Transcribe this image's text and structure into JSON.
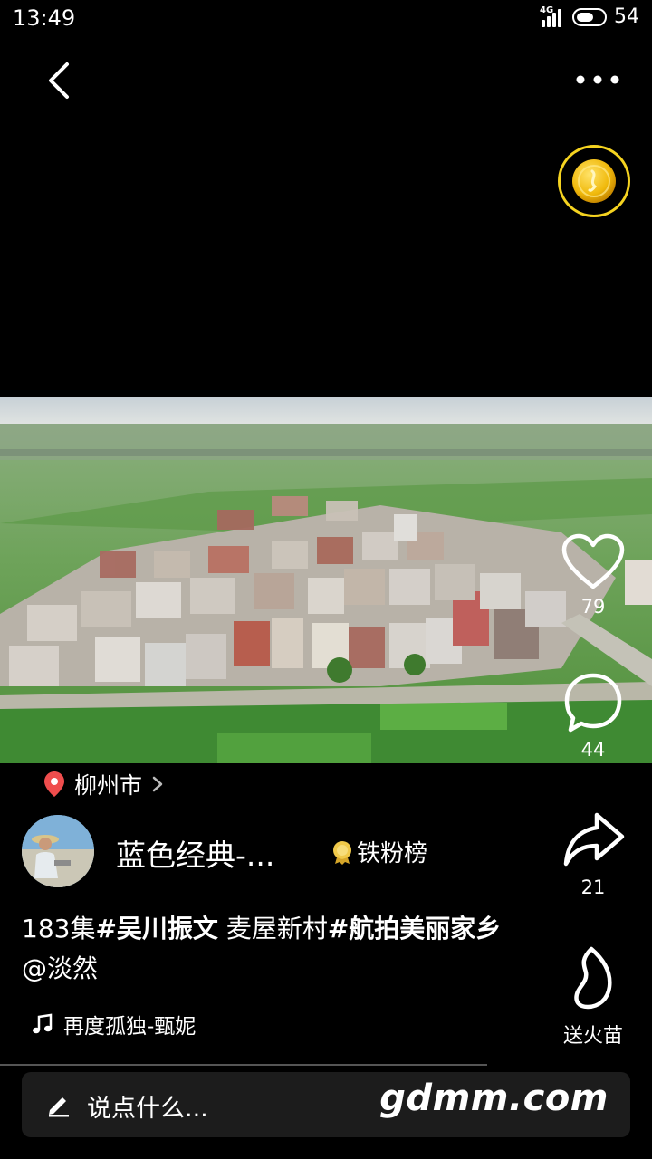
{
  "status_bar": {
    "time": "13:49",
    "network": "4G",
    "battery_level": "54"
  },
  "icons": {
    "back": "back-chevron-icon",
    "more": "more-dots-icon",
    "coin": "gold-coin-icon",
    "like": "heart-icon",
    "comment": "comment-bubble-icon",
    "share": "share-arrow-icon",
    "fire": "flame-icon",
    "location": "location-pin-icon",
    "music": "music-note-icon",
    "pen": "pen-icon"
  },
  "location": {
    "city": "柳州市"
  },
  "author": {
    "name": "蓝色经典-...",
    "fan_badge": "铁粉榜"
  },
  "actions": {
    "likes": "79",
    "comments": "44",
    "shares": "21",
    "fire_label": "送火苗"
  },
  "caption": {
    "part1": "183集",
    "tag1": "#吴川振文",
    "part2": " 麦屋新村",
    "tag2": "#航拍美丽家乡",
    "mention": " @淡然"
  },
  "music": {
    "title": "再度孤独-甄妮"
  },
  "comment_input": {
    "placeholder": "说点什么..."
  },
  "watermark": "gdmm.com",
  "colors": {
    "coin_ring": "#f5d320",
    "location_pin": "#ef4d4d",
    "background": "#000000"
  }
}
